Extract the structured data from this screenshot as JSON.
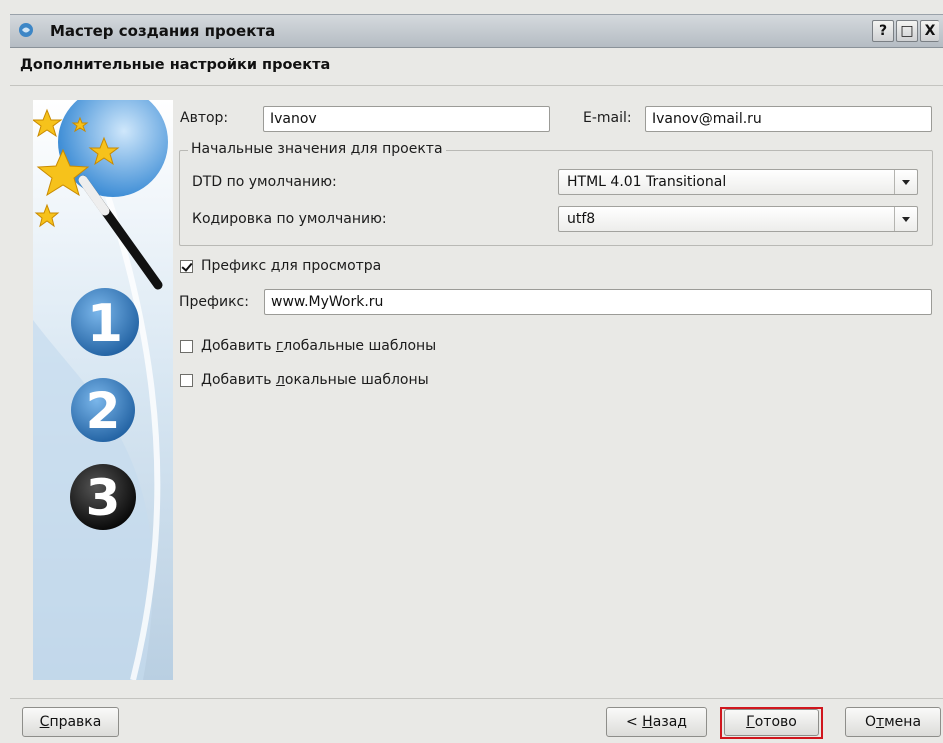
{
  "window": {
    "title": "Мастер создания проекта",
    "help_glyph": "?",
    "maximize_glyph": "□",
    "close_glyph": "X"
  },
  "page": {
    "subtitle": "Дополнительные настройки проекта"
  },
  "form": {
    "author_label": "Автор:",
    "author_value": "Ivanov",
    "email_label": "E-mail:",
    "email_value": "Ivanov@mail.ru",
    "group_title": "Начальные значения для проекта",
    "dtd_label": "DTD по умолчанию:",
    "dtd_value": "HTML 4.01 Transitional",
    "encoding_label": "Кодировка по умолчанию:",
    "encoding_value": "utf8",
    "preview_prefix_label_pre": "Префикс ",
    "preview_prefix_label_u": "д",
    "preview_prefix_label_post": "ля просмотра",
    "preview_prefix_checked": true,
    "prefix_label": "Префикс:",
    "prefix_value": "www.MyWork.ru",
    "global_templates_pre": "Добавить ",
    "global_templates_u": "г",
    "global_templates_post": "лобальные шаблоны",
    "global_templates_checked": false,
    "local_templates_pre": "Добавить ",
    "local_templates_u": "л",
    "local_templates_post": "окальные шаблоны",
    "local_templates_checked": false
  },
  "wizard_steps": [
    "1",
    "2",
    "3"
  ],
  "buttons": {
    "help_u": "С",
    "help_rest": "правка",
    "back_pre": "< ",
    "back_u": "Н",
    "back_rest": "азад",
    "finish_u": "Г",
    "finish_rest": "отово",
    "cancel_pre": "О",
    "cancel_u": "т",
    "cancel_rest": "мена"
  },
  "colors": {
    "highlight_box": "#d0161d",
    "step_active": "#1a1a1a",
    "step_inactive": "#2f7fc4"
  }
}
